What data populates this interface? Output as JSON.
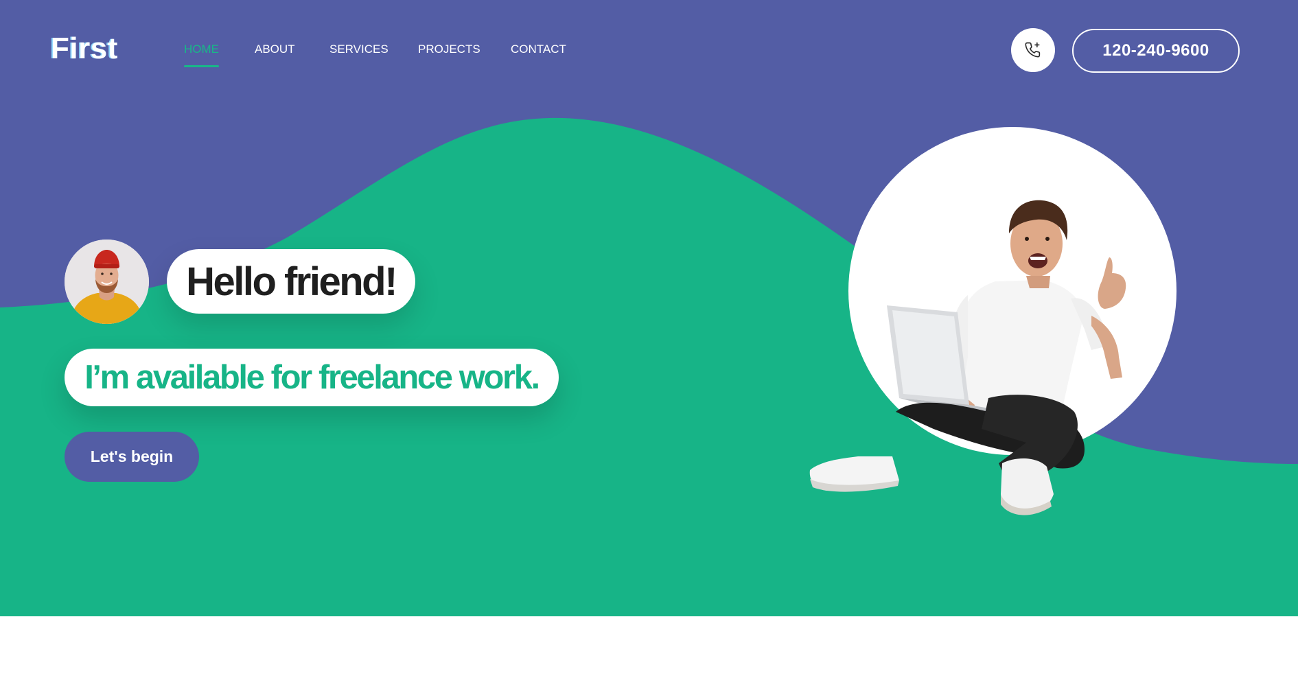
{
  "header": {
    "logo": "First",
    "nav": [
      {
        "label": "HOME",
        "active": true
      },
      {
        "label": "ABOUT",
        "active": false
      },
      {
        "label": "SERVICES",
        "active": false
      },
      {
        "label": "PROJECTS",
        "active": false
      },
      {
        "label": "CONTACT",
        "active": false
      }
    ],
    "call_icon": "phone-call-icon",
    "phone_number": "120-240-9600"
  },
  "hero": {
    "greeting": "Hello friend!",
    "tagline": "I’m available for freelance work.",
    "cta_label": "Let's begin"
  },
  "colors": {
    "primary": "#535da5",
    "accent": "#17b487",
    "white": "#ffffff",
    "dark_text": "#1f1f1f"
  }
}
